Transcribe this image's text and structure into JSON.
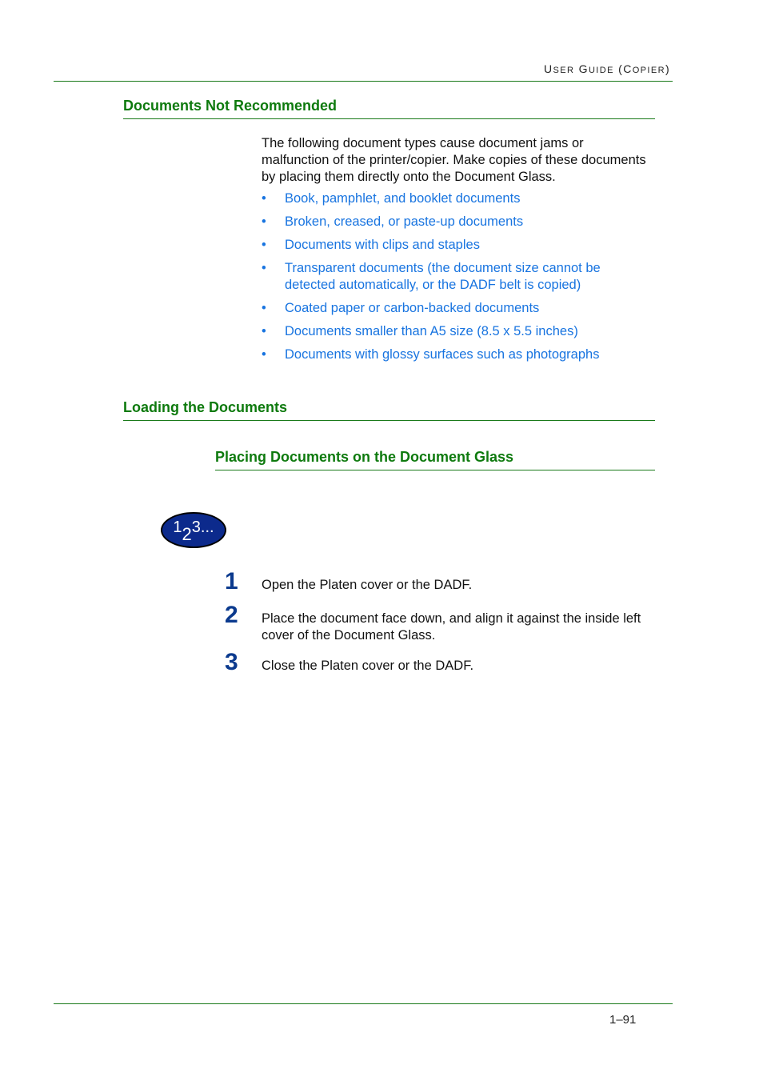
{
  "header": {
    "running_head_u": "U",
    "running_head_ser": "ser",
    "running_head_g": "G",
    "running_head_uide": "uide",
    "running_head_open": "(",
    "running_head_c": "C",
    "running_head_opier": "opier",
    "running_head_close": ")",
    "running_head_full": "User Guide (Copier)"
  },
  "section1": {
    "heading": "Documents Not Recommended",
    "intro_line1": "The following document types cause document jams or",
    "intro_line2": "malfunction of the printer/copier. Make copies of these documents",
    "intro_line3": "by placing them directly onto the Document Glass.",
    "bullet_glyph": "•",
    "items": [
      {
        "line1": "Book, pamphlet, and booklet documents",
        "line2": ""
      },
      {
        "line1": "Broken, creased, or paste-up documents",
        "line2": ""
      },
      {
        "line1": "Documents with clips and staples",
        "line2": ""
      },
      {
        "line1": "Transparent documents (the document size cannot be",
        "line2": "detected automatically, or the DADF belt is copied)"
      },
      {
        "line1": "Coated paper or carbon-backed documents",
        "line2": ""
      },
      {
        "line1": "Documents smaller than A5 size (8.5 x 5.5 inches)",
        "line2": ""
      },
      {
        "line1": "Documents with glossy surfaces such as photographs",
        "line2": ""
      }
    ]
  },
  "section2": {
    "heading": "Loading the Documents",
    "subheading": "Placing Documents on the Document Glass",
    "procedure_icon": {
      "d1": "1",
      "d2": "2",
      "d3": "3..."
    },
    "steps": [
      {
        "number": "1",
        "line1": "Open the Platen cover or the DADF.",
        "line2": ""
      },
      {
        "number": "2",
        "line1": "Place the document face down, and align it against the inside left",
        "line2": "cover of the Document Glass."
      },
      {
        "number": "3",
        "line1": "Close the Platen cover or the DADF.",
        "line2": ""
      }
    ]
  },
  "footer": {
    "page_number": "1–91"
  },
  "colors": {
    "heading_green": "#0e7a0e",
    "bullet_blue": "#1874e0",
    "step_number_blue": "#0b3a8e",
    "badge_navy": "#0c2a8c"
  }
}
